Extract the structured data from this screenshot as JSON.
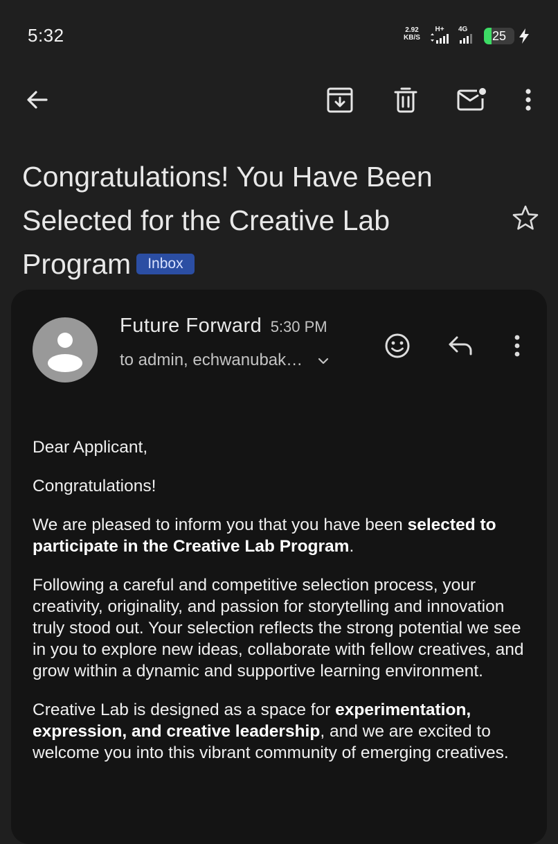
{
  "status_bar": {
    "time": "5:32",
    "net_speed_value": "2.92",
    "net_speed_unit": "KB/S",
    "network_1": "H+",
    "network_2": "4G",
    "battery_level": "25",
    "battery_fill_fraction": 0.25
  },
  "toolbar": {
    "back_icon": "arrow-left",
    "archive_icon": "archive-box",
    "delete_icon": "trash-can",
    "mark_unread_icon": "mail-with-dot",
    "more_icon": "vertical-dots"
  },
  "email": {
    "subject": "Congratulations! You Have Been Selected for the Creative Lab Program",
    "label": "Inbox",
    "sender": "Future Forward",
    "time": "5:30 PM",
    "recipients": "to admin, echwanubak…",
    "body": {
      "greeting": "Dear Applicant,",
      "congrats": "Congratulations!",
      "p1_before": "We are pleased to inform you that you have been ",
      "p1_bold": "selected to participate in the Creative Lab Program",
      "p1_after": ".",
      "p2": "Following a careful and competitive selection process, your creativity, originality, and passion for storytelling and innovation truly stood out. Your selection reflects the strong potential we see in you to explore new ideas, collaborate with fellow creatives, and grow within a dynamic and supportive learning environment.",
      "p3_before": "Creative Lab is designed as a space for ",
      "p3_bold": "experimentation, expression, and creative leadership",
      "p3_after": ", and we are excited to welcome you into this vibrant community of emerging creatives."
    }
  },
  "colors": {
    "background": "#1f1f1f",
    "card": "#141414",
    "badge": "#2b4ea3",
    "battery": "#3ddc65",
    "avatar": "#999999"
  }
}
